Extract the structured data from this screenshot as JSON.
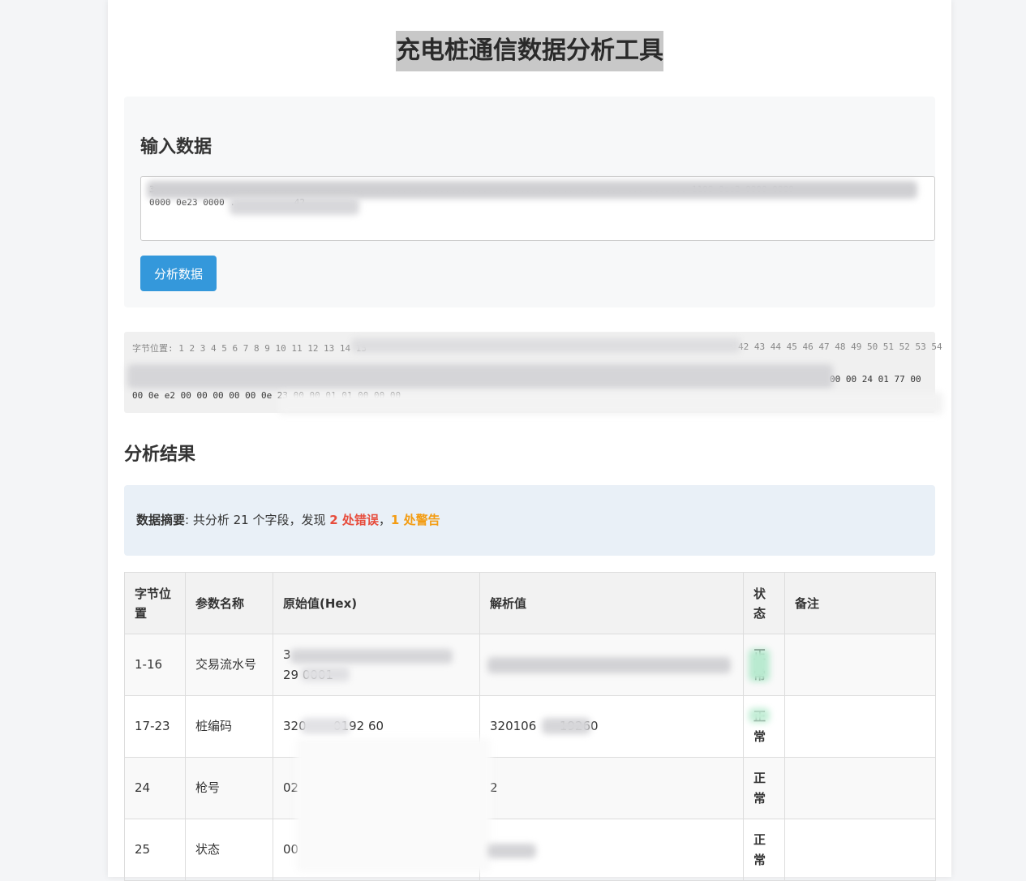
{
  "page": {
    "title": "充电桩通信数据分析工具"
  },
  "input": {
    "heading": "输入数据",
    "textarea_value": "3... ... ... ... ... ... ... ... ... ... ... ... ... ... ... ... ... ... ... ... ... ... ... ... ... 1100 0ee2 0000 0000\n0000 0e23 0000 ... ... ... 42",
    "analyze_button": "分析数据"
  },
  "hex_view": {
    "positions_label": "字节位置:",
    "positions_head": "1 2 3 4 5 6 7 8 9 10 11 12 13 14 15",
    "positions_tail": "42 43 44 45 46 47 48 49 50 51 52 53 54",
    "bytes_tail_1": "00 00 24 01 77 00",
    "bytes_head_2": "00 0e e2 00 00 00 00 00 0e 23 00 00 01 01 00 00 00"
  },
  "results": {
    "heading": "分析结果",
    "summary": {
      "label": "数据摘要",
      "text_before": ": 共分析 21 个字段，发现 ",
      "errors": "2 处错误",
      "separator": "，",
      "warnings": "1 处警告"
    },
    "columns": [
      "字节位置",
      "参数名称",
      "原始值(Hex)",
      "解析值",
      "状态",
      "备注"
    ],
    "rows": [
      {
        "pos": "1-16",
        "name": "交易流水号",
        "raw": "3\n29       0001",
        "parsed": "",
        "status": "正常",
        "note": ""
      },
      {
        "pos": "17-23",
        "name": "桩编码",
        "raw": "320       0192 60",
        "parsed": "320106      19260",
        "status": "正常",
        "note": ""
      },
      {
        "pos": "24",
        "name": "枪号",
        "raw": "02",
        "parsed": "2",
        "status": "正常",
        "note": ""
      },
      {
        "pos": "25",
        "name": "状态",
        "raw": "00",
        "parsed": "",
        "status": "正常",
        "note": ""
      }
    ]
  },
  "colors": {
    "accent": "#3498db",
    "error": "#e74c3c",
    "warning": "#f39c12",
    "ok": "#27ae60"
  }
}
